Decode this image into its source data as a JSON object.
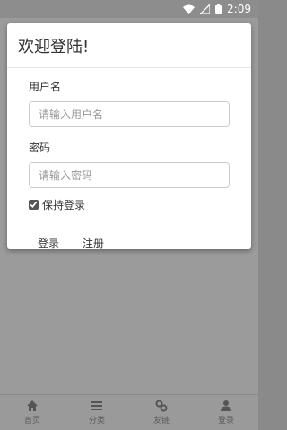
{
  "status_bar": {
    "time": "2:09"
  },
  "dialog": {
    "title": "欢迎登陆!",
    "username": {
      "label": "用户名",
      "placeholder": "请输入用户名"
    },
    "password": {
      "label": "密码",
      "placeholder": "请输入密码"
    },
    "remember": {
      "label": "保持登录",
      "checked": true
    },
    "login_button": "登录",
    "register_button": "注册"
  },
  "tab_bar": {
    "items": [
      {
        "label": "首页",
        "icon": "home-icon"
      },
      {
        "label": "分类",
        "icon": "list-icon"
      },
      {
        "label": "友链",
        "icon": "link-icon"
      },
      {
        "label": "登录",
        "icon": "user-icon"
      }
    ]
  },
  "colors": {
    "overlay": "#8a8a8a",
    "dialog_bg": "#ffffff",
    "tab_text": "#5a5a5a"
  }
}
